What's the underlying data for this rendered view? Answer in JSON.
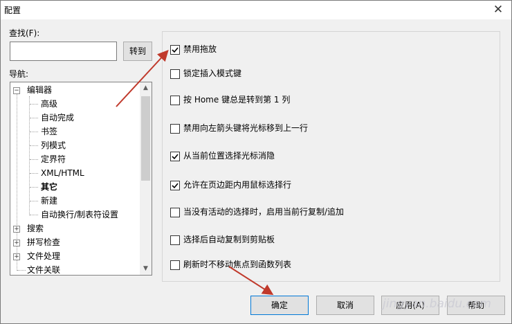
{
  "window": {
    "title": "配置",
    "close_glyph": "✕"
  },
  "find": {
    "label": "查找(F):",
    "value": "",
    "goto_label": "转到"
  },
  "nav": {
    "label": "导航:",
    "items": [
      {
        "label": "编辑器",
        "expander": "⊟"
      },
      {
        "label": "高级"
      },
      {
        "label": "自动完成"
      },
      {
        "label": "书签"
      },
      {
        "label": "列模式"
      },
      {
        "label": "定界符"
      },
      {
        "label": "XML/HTML"
      },
      {
        "label": "其它"
      },
      {
        "label": "新建"
      },
      {
        "label": "自动换行/制表符设置"
      },
      {
        "label": "搜索",
        "expander": "⊞"
      },
      {
        "label": "拼写检查",
        "expander": "⊞"
      },
      {
        "label": "文件处理",
        "expander": "⊞"
      },
      {
        "label": "文件关联"
      }
    ]
  },
  "options": [
    {
      "label": "禁用拖放",
      "checked": true
    },
    {
      "label": "锁定插入模式键",
      "checked": false
    },
    {
      "label": "按 Home 键总是转到第 1 列",
      "checked": false
    },
    {
      "label": "禁用向左箭头键将光标移到上一行",
      "checked": false
    },
    {
      "label": "从当前位置选择光标消隐",
      "checked": true
    },
    {
      "label": "允许在页边距内用鼠标选择行",
      "checked": true
    },
    {
      "label": "当没有活动的选择时，启用当前行复制/追加",
      "checked": false
    },
    {
      "label": "选择后自动复制到剪贴板",
      "checked": false
    },
    {
      "label": "刷新时不移动焦点到函数列表",
      "checked": false
    }
  ],
  "buttons": {
    "ok": "确定",
    "cancel": "取消",
    "apply": "应用(A)",
    "help": "帮助"
  },
  "watermark": "jingyan.baidu.com",
  "icons": {
    "scroll_up": "▲",
    "scroll_down": "▼",
    "check": "check-icon"
  },
  "colors": {
    "annotation_arrow": "#c0392b",
    "default_button_border": "#0078d7"
  }
}
